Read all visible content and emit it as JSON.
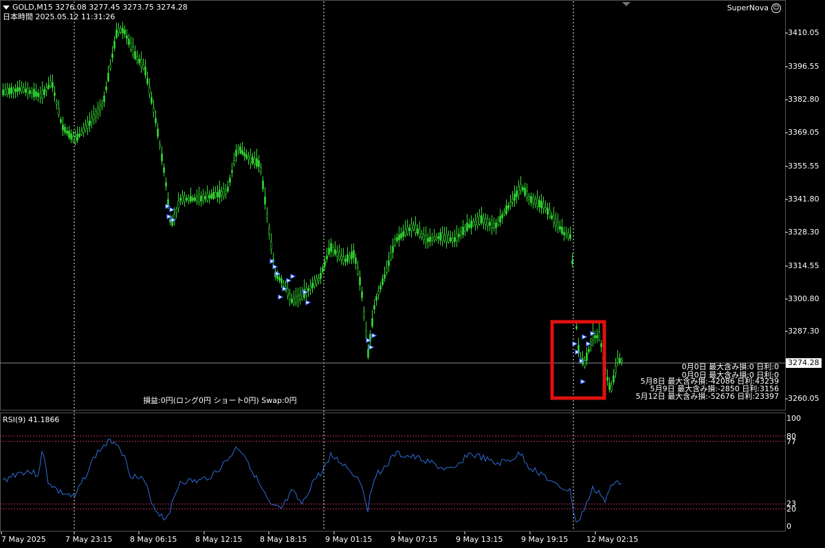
{
  "header": {
    "symbol_line": "GOLD,M15  3276.08 3277.45 3273.75 3274.28",
    "timezone_line": "日本時間 2025.05.12 11:31:26",
    "ea_name": "SuperNova",
    "ea_icon": "smiley-icon"
  },
  "price_axis": {
    "labels": [
      "3410.05",
      "3396.55",
      "3382.80",
      "3369.05",
      "3355.55",
      "3341.80",
      "3328.30",
      "3314.55",
      "3300.80",
      "3287.30",
      "3260.05"
    ],
    "current_price": "3274.28"
  },
  "time_axis": {
    "labels": [
      "7 May 2025",
      "7 May 23:15",
      "8 May 06:15",
      "8 May 12:15",
      "8 May 18:15",
      "9 May 01:15",
      "9 May 07:15",
      "9 May 13:15",
      "9 May 19:15",
      "12 May 02:15"
    ]
  },
  "rsi": {
    "title": "RSI(9) 41.1866",
    "levels": [
      "100",
      "80",
      "77",
      "23",
      "20",
      "0"
    ],
    "level_color": "#c0305a",
    "line_color": "#2f6fdc"
  },
  "overlay": {
    "pnl_text": "損益:0円(ロング0円  ショート0円)  Swap:0円",
    "stats": [
      "0月0日  最大含み損:0  日利:0",
      "0月0日  最大含み損:0  日利:0",
      "5月8日  最大含み損:-42086  日利:43239",
      "5月9日  最大含み損:-2850  日利:3156",
      "5月12日  最大含み損:-52676  日利:23397"
    ]
  },
  "colors": {
    "candle": "#33dd33",
    "candle_highlight": "#aaff66",
    "marker": "#3a6cff",
    "highlight_box": "#e01010",
    "grid": "#ffffff"
  }
}
